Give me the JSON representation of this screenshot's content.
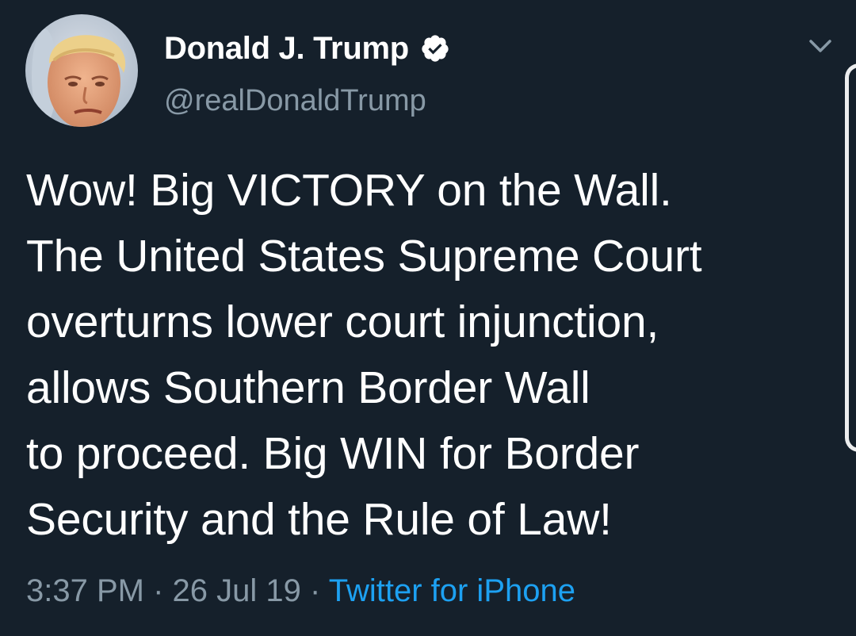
{
  "author": {
    "display_name": "Donald J. Trump",
    "handle": "@realDonaldTrump",
    "verified_icon": "verified-badge-icon",
    "avatar_icon": "profile-photo"
  },
  "tweet": {
    "lines": [
      "Wow! Big VICTORY on the Wall.",
      "The United States Supreme Court",
      "overturns lower court injunction,",
      "allows Southern Border Wall",
      "to proceed. Big WIN for Border",
      "Security and the Rule of Law!"
    ],
    "time": "3:37 PM",
    "separator": "·",
    "date": "26 Jul 19",
    "source": "Twitter for iPhone"
  },
  "menu": {
    "icon": "chevron-down-icon"
  },
  "colors": {
    "background": "#15202b",
    "text": "#ffffff",
    "secondary": "#8899a6",
    "link": "#1da1f2"
  }
}
